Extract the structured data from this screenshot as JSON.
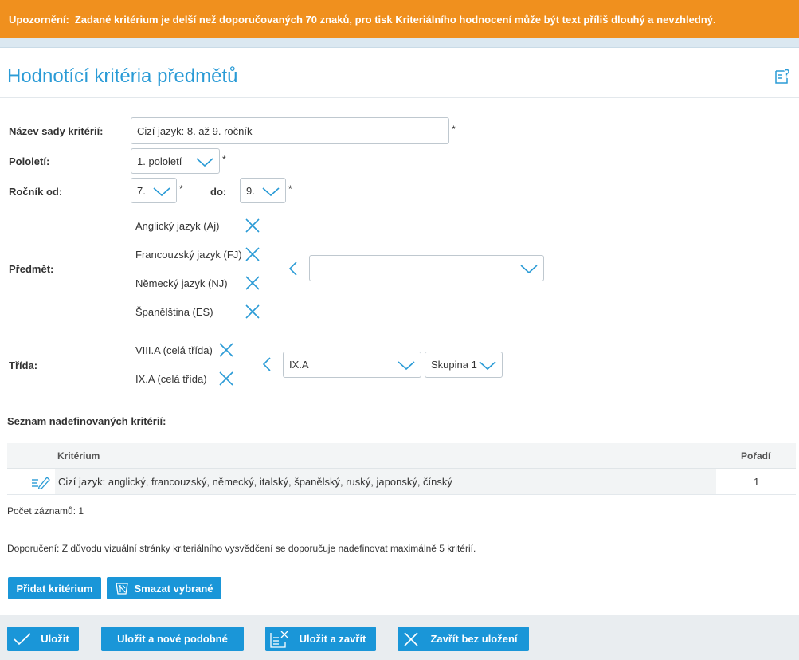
{
  "warning": {
    "label": "Upozornění:",
    "message": "Zadané kritérium je delší než doporučovaných 70 znaků, pro tisk Kriteriálního hodnocení může být text příliš dlouhý a nevzhledný."
  },
  "page": {
    "title": "Hodnotící kritéria předmětů"
  },
  "form": {
    "name_label": "Název sady kritérií:",
    "name_value": "Cizí jazyk: 8. až 9. ročník",
    "semester_label": "Pololetí:",
    "semester_value": "1. pololetí",
    "grade_from_label": "Ročník od:",
    "grade_from_value": "7.",
    "grade_to_label": "do:",
    "grade_to_value": "9.",
    "required_mark": "*",
    "subject_label": "Předmět:",
    "subjects": [
      {
        "label": "Anglický jazyk (Aj)"
      },
      {
        "label": "Francouzský jazyk (FJ)"
      },
      {
        "label": "Německý jazyk (NJ)"
      },
      {
        "label": "Španělština (ES)"
      }
    ],
    "subject_select_value": "",
    "class_label": "Třída:",
    "classes": [
      {
        "label": "VIII.A (celá třída)"
      },
      {
        "label": "IX.A (celá třída)"
      }
    ],
    "class_select_value": "IX.A",
    "group_select_value": "Skupina 1"
  },
  "criteria": {
    "section_title": "Seznam nadefinovaných kritérií:",
    "columns": {
      "criterion": "Kritérium",
      "order": "Pořadí"
    },
    "rows": [
      {
        "criterion": "Cizí jazyk: anglický, francouzský, německý, italský, španělský, ruský, japonský, čínský",
        "order": "1"
      }
    ],
    "count_label": "Počet záznamů: 1",
    "recommendation": "Doporučení: Z důvodu vizuální stránky kriteriálního vysvědčení se doporučuje nadefinovat maximálně 5 kritérií."
  },
  "actions": {
    "add_criterion": "Přidat kritérium",
    "delete_selected": "Smazat vybrané"
  },
  "footer": {
    "save": "Uložit",
    "save_new_similar": "Uložit a nové podobné",
    "save_close": "Uložit a zavřít",
    "close_no_save": "Zavřít bez uložení"
  },
  "colors": {
    "warning_bg": "#f0901e",
    "accent": "#1a96d8",
    "title": "#2a9bd6"
  },
  "icons": [
    "help-icon",
    "chevron-down-icon",
    "close-icon",
    "chevron-left-icon",
    "edit-icon",
    "delete-icon",
    "check-icon",
    "save-close-icon"
  ]
}
